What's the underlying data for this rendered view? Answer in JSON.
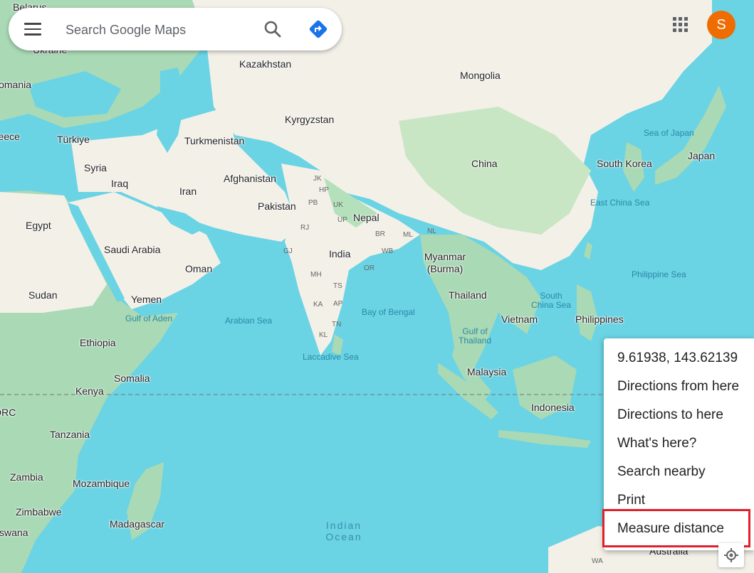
{
  "search": {
    "placeholder": "Search Google Maps"
  },
  "user": {
    "avatar_initial": "S",
    "avatar_color": "#ef6c00"
  },
  "icons": {
    "menu": "hamburger-menu-icon",
    "search": "search-icon",
    "directions": "directions-icon",
    "apps": "apps-grid-icon",
    "locate": "my-location-icon"
  },
  "context_menu": {
    "coordinates": "9.61938, 143.62139",
    "items": [
      "Directions from here",
      "Directions to here",
      "What's here?",
      "Search nearby",
      "Print",
      "Measure distance"
    ],
    "highlighted": "Measure distance"
  },
  "map": {
    "colors": {
      "water": "#6ad3e4",
      "land": "#f3f0e8",
      "vegetation": "#a8dab5",
      "highlight": "#e0202a"
    },
    "countries": [
      "Belarus",
      "Ukraine",
      "Romania",
      "Greece",
      "Türkiye",
      "Syria",
      "Iraq",
      "Iran",
      "Egypt",
      "Saudi Arabia",
      "Oman",
      "Yemen",
      "Sudan",
      "Ethiopia",
      "Somalia",
      "Kenya",
      "DRC",
      "Tanzania",
      "Zambia",
      "Mozambique",
      "Zimbabwe",
      "Botswana",
      "Madagascar",
      "Kazakhstan",
      "Turkmenistan",
      "Kyrgyzstan",
      "Afghanistan",
      "Pakistan",
      "Nepal",
      "India",
      "Mongolia",
      "China",
      "South Korea",
      "Japan",
      "Myanmar (Burma)",
      "Thailand",
      "Vietnam",
      "Philippines",
      "Malaysia",
      "Indonesia",
      "Australia"
    ],
    "seas": [
      "Sea of Japan",
      "East China Sea",
      "Philippine Sea",
      "South China Sea",
      "Bay of Bengal",
      "Arabian Sea",
      "Laccadive Sea",
      "Gulf of Aden",
      "Gulf of Thailand"
    ],
    "ocean": "Indian Ocean",
    "regions": [
      "JK",
      "HP",
      "PB",
      "UK",
      "UP",
      "RJ",
      "GJ",
      "BR",
      "WB",
      "MH",
      "OR",
      "TS",
      "KA",
      "AP",
      "TN",
      "KL",
      "ML",
      "NL",
      "WA"
    ]
  }
}
